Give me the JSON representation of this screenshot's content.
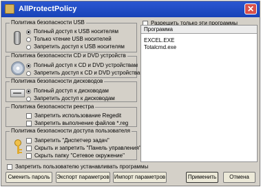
{
  "window": {
    "title": "AllProtectPolicy"
  },
  "usb": {
    "title": "Политика безопасности USB",
    "options": [
      "Полный доступ к USB носителям",
      "Только чтение USB носителей",
      "Запретить доступ к USB носителям"
    ],
    "selected_index": 0,
    "icon": "usb-drive-icon"
  },
  "cd": {
    "title": "Политика безопасности CD и DVD устройств",
    "options": [
      "Полный доступ к CD и DVD устройствам",
      "Запретить доступ к CD и DVD устройствам"
    ],
    "selected_index": 0,
    "icon": "cd-icon"
  },
  "disk": {
    "title": "Политика безопасности дисководов",
    "options": [
      "Полный доступ к дисководам",
      "Запретить доступ к дисководам"
    ],
    "selected_index": 0,
    "icon": "floppy-drive-icon"
  },
  "registry": {
    "title": "Политика безопасности реестра",
    "options": [
      "Запретить использование Regedit",
      "Запретить выполнение файлов *.reg"
    ]
  },
  "user": {
    "title": "Политика безопасности доступа пользователя",
    "options": [
      "Запретить \"Диспетчер задач\"",
      "Скрыть и запретить \"Панель управления\"",
      "Скрыть папку \"Сетевое окружение\""
    ],
    "icon": "key-icon"
  },
  "programs": {
    "allow_only_label": "Разрешить только эти программы",
    "header": "Программа",
    "items": [
      "EXCEL.EXE",
      "Totalcmd.exe"
    ]
  },
  "footer": {
    "forbid_install_label": "Запретить пользователю устанавливать программы",
    "buttons": {
      "change_password": "Сменить пароль",
      "export": "Экспорт параметров",
      "import": "Импорт параметров",
      "apply": "Применить",
      "cancel": "Отмена"
    }
  }
}
